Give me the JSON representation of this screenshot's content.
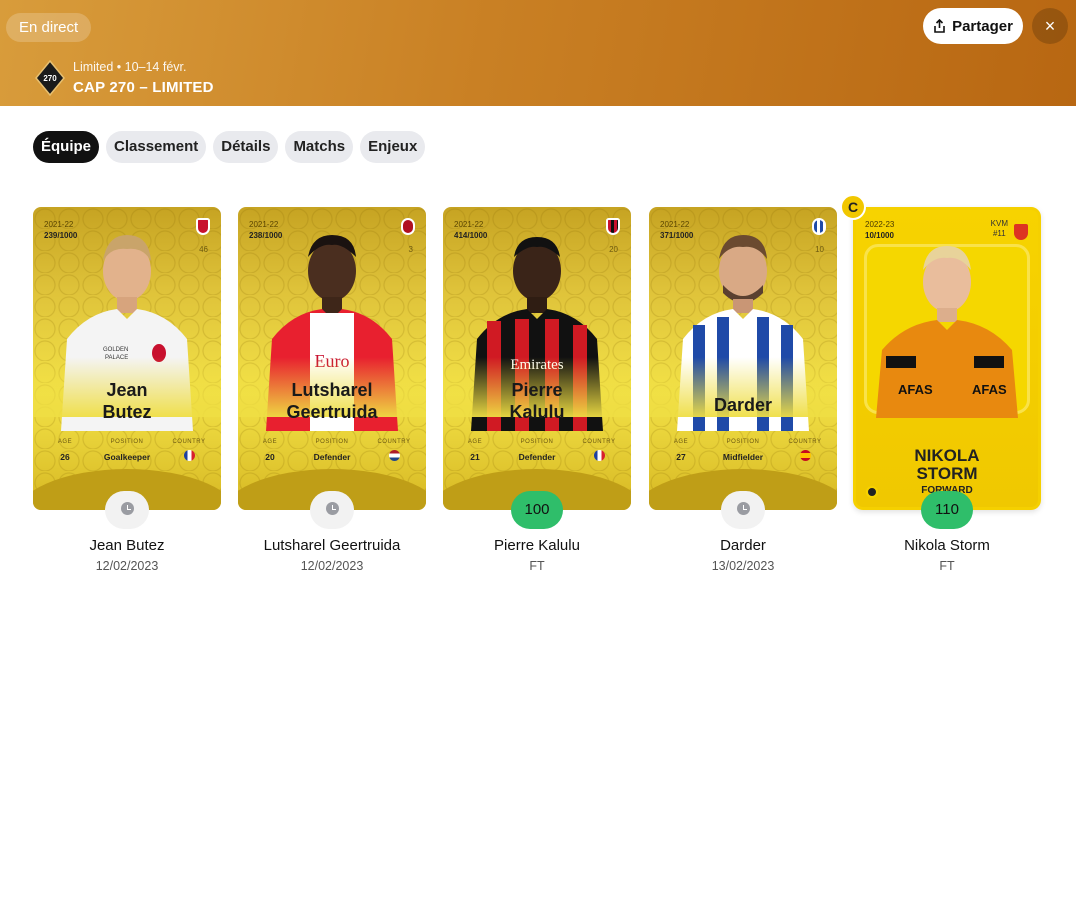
{
  "header": {
    "live_label": "En direct",
    "share_label": "Partager",
    "close_label": "×",
    "logo_text": "270",
    "subtitle": "Limited • 10–14 févr.",
    "title": "CAP 270 – LIMITED"
  },
  "tabs": [
    {
      "label": "Équipe",
      "active": true
    },
    {
      "label": "Classement"
    },
    {
      "label": "Détails"
    },
    {
      "label": "Matchs"
    },
    {
      "label": "Enjeux"
    }
  ],
  "stat_keys": {
    "age": "AGE",
    "position": "POSITION",
    "country": "COUNTRY"
  },
  "players": [
    {
      "card_name_1": "Jean",
      "card_name_2": "Butez",
      "season": "2021-22",
      "serial": "239/1000",
      "club_number": "46",
      "age": "26",
      "position": "Goalkeeper",
      "status": "clock",
      "name": "Jean Butez",
      "date": "12/02/2023"
    },
    {
      "card_name_1": "Lutsharel",
      "card_name_2": "Geertruida",
      "season": "2021-22",
      "serial": "238/1000",
      "club_number": "3",
      "age": "20",
      "position": "Defender",
      "status": "clock",
      "name": "Lutsharel Geertruida",
      "date": "12/02/2023"
    },
    {
      "card_name_1": "Pierre",
      "card_name_2": "Kalulu",
      "season": "2021-22",
      "serial": "414/1000",
      "club_number": "20",
      "age": "21",
      "position": "Defender",
      "status": "score",
      "score": "100",
      "name": "Pierre Kalulu",
      "date": "FT"
    },
    {
      "card_name_1": "Darder",
      "season": "2021-22",
      "serial": "371/1000",
      "club_number": "10",
      "age": "27",
      "position": "Midfielder",
      "status": "clock",
      "name": "Darder",
      "date": "13/02/2023"
    },
    {
      "card_name_1": "NIKOLA",
      "card_name_2": "STORM",
      "season": "2022-23",
      "serial": "10/1000",
      "club_code": "KVM",
      "club_number": "#11",
      "position": "FORWARD",
      "captain": "C",
      "status": "score",
      "score": "110",
      "name": "Nikola Storm",
      "date": "FT"
    }
  ],
  "colors": {
    "score_green": "#2fbe6a",
    "header_start": "#d89c3b",
    "header_end": "#b86712"
  }
}
